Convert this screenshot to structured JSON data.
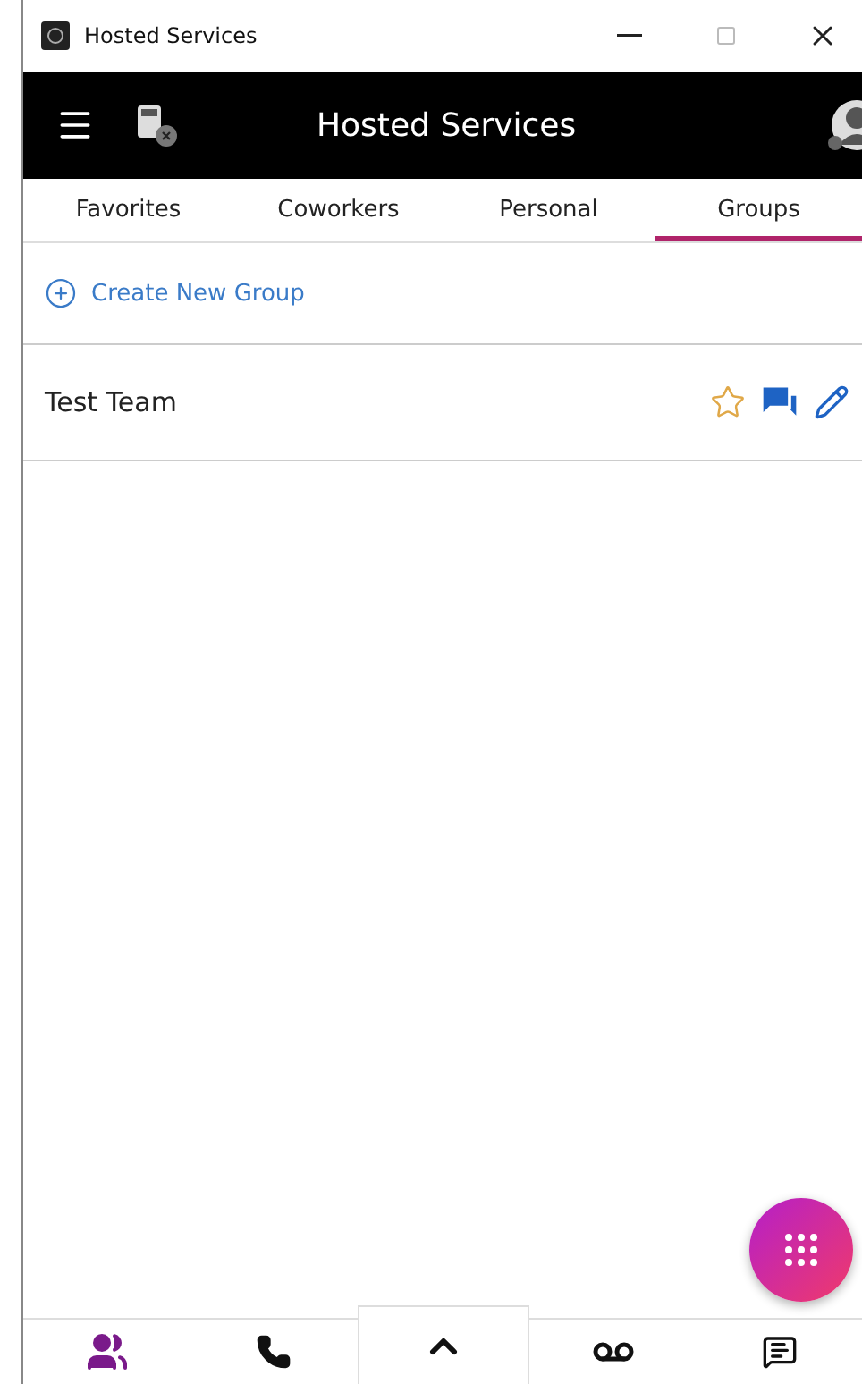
{
  "window": {
    "title": "Hosted Services"
  },
  "header": {
    "title": "Hosted Services"
  },
  "tabs": [
    {
      "label": "Favorites",
      "selected": false
    },
    {
      "label": "Coworkers",
      "selected": false
    },
    {
      "label": "Personal",
      "selected": false
    },
    {
      "label": "Groups",
      "selected": true
    }
  ],
  "create_group": {
    "label": "Create New Group"
  },
  "groups": [
    {
      "name": "Test Team",
      "favorite": false
    }
  ],
  "bottom_nav": [
    {
      "kind": "contacts",
      "selected": true
    },
    {
      "kind": "calls",
      "selected": false
    },
    {
      "kind": "expand",
      "selected": false
    },
    {
      "kind": "voicemail",
      "selected": false
    },
    {
      "kind": "messages",
      "selected": false
    }
  ]
}
